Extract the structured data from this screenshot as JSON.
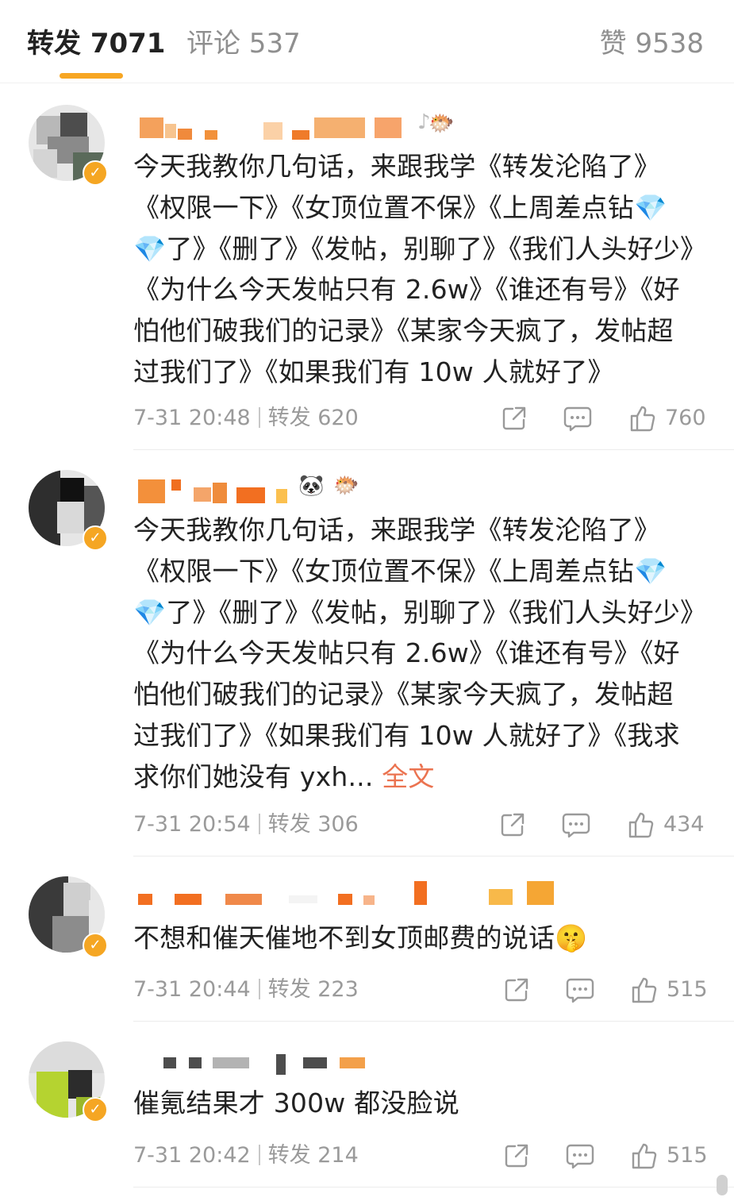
{
  "tabs": {
    "reposts": "转发 7071",
    "comments": "评论 537",
    "likes": "赞 9538"
  },
  "icons": {
    "share": "share-icon",
    "comment": "comment-icon",
    "like": "thumbs-up-icon",
    "verified": "verified-badge-icon"
  },
  "colors": {
    "accent": "#f7a623",
    "link": "#eb7350",
    "meta": "#9a9a9a"
  },
  "comments": [
    {
      "name_emoji": "🐡",
      "body_1": "今天我教你几句话，来跟我学《转发沦陷了》《权限一下》《女顶位置不保》《上周差点钻",
      "gem_1": "💎",
      "gem_2": "💎",
      "body_2": "了》《删了》《发帖，别聊了》《我们人头好少》《为什么今天发帖只有 2.6w》《谁还有号》《好怕他们破我们的记录》《某家今天疯了，发帖超过我们了》《如果我们有 10w 人就好了》",
      "time": "7-31 20:48",
      "reposts": "转发 620",
      "likes": "760"
    },
    {
      "name_emoji_1": "🐼",
      "name_emoji_2": "🐡",
      "body_1": "今天我教你几句话，来跟我学《转发沦陷了》《权限一下》《女顶位置不保》《上周差点钻",
      "gem_1": "💎",
      "gem_2": "💎",
      "body_2": "了》《删了》《发帖，别聊了》《我们人头好少》《为什么今天发帖只有 2.6w》《谁还有号》《好怕他们破我们的记录》《某家今天疯了，发帖超过我们了》《如果我们有 10w 人就好了》《我求求你们她没有 yxh...",
      "more": " 全文",
      "time": "7-31 20:54",
      "reposts": "转发 306",
      "likes": "434"
    },
    {
      "body": "不想和催天催地不到女顶邮费的说话",
      "emoji": "🤫",
      "time": "7-31 20:44",
      "reposts": "转发 223",
      "likes": "515"
    },
    {
      "body": "催氪结果才 300w 都没脸说",
      "time": "7-31 20:42",
      "reposts": "转发 214",
      "likes": "515"
    }
  ]
}
